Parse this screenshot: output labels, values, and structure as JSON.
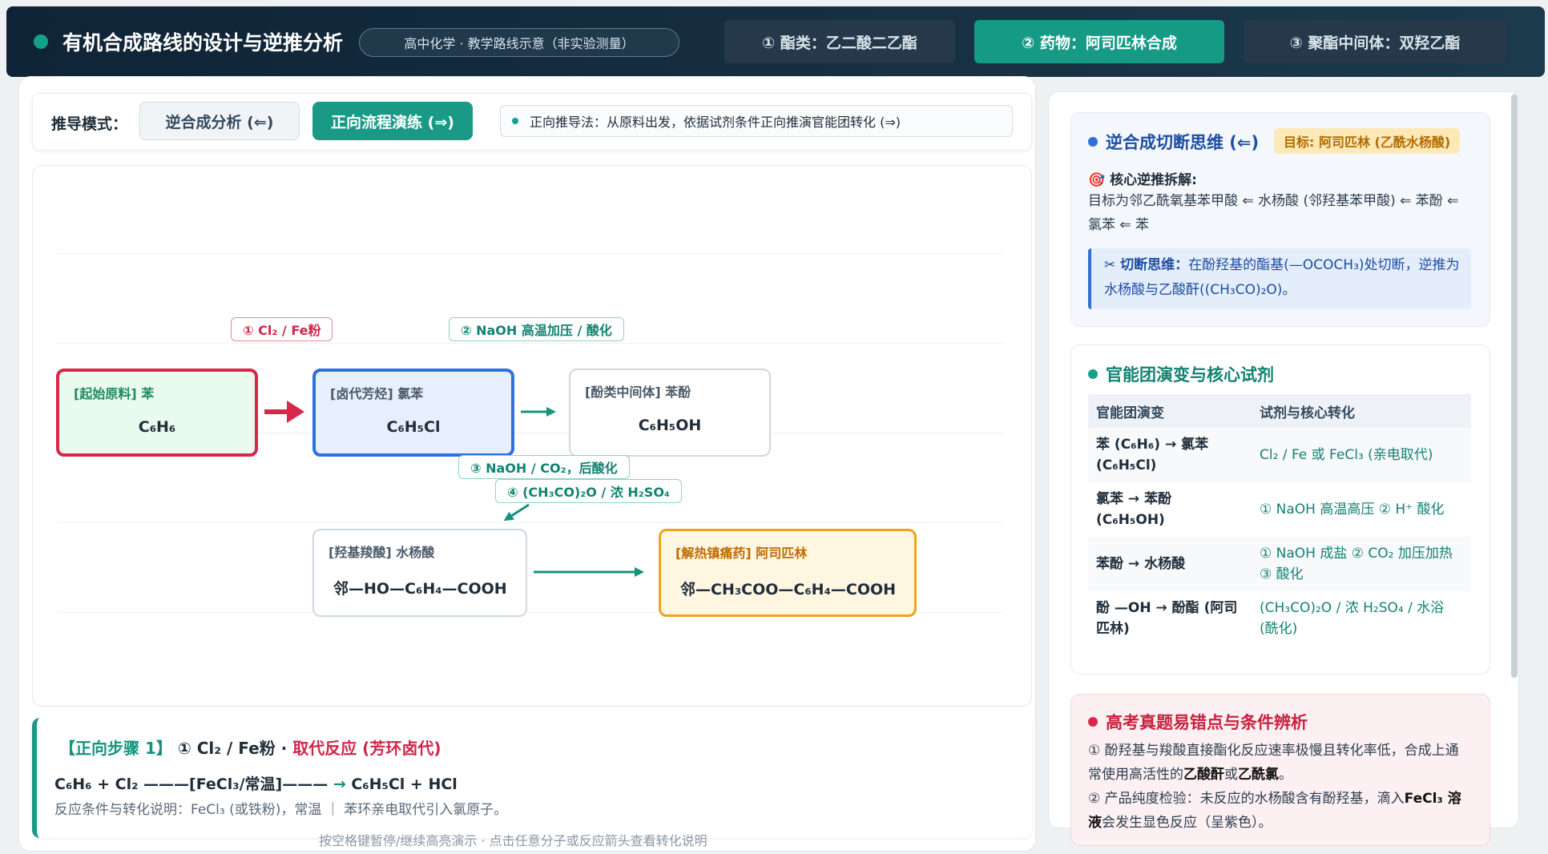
{
  "header": {
    "title": "有机合成路线的设计与逆推分析",
    "badge": "高中化学 · 教学路线示意（非实验测量）",
    "tabs": [
      {
        "label": "① 酯类：乙二酸二乙酯",
        "active": false
      },
      {
        "label": "② 药物：阿司匹林合成",
        "active": true
      },
      {
        "label": "③ 聚酯中间体：双羟乙酯",
        "active": false
      }
    ]
  },
  "mode": {
    "label": "推导模式：",
    "options": [
      "逆合成分析 (⇐)",
      "正向流程演练 (⇒)"
    ],
    "active": "正向流程演练 (⇒)",
    "hint": "正向推导法：从原料出发，依据试剂条件正向推演官能团转化 (⇒)"
  },
  "nodes": [
    {
      "label": "[起始原料] 苯",
      "formula": "C₆H₆"
    },
    {
      "label": "[卤代芳烃] 氯苯",
      "formula": "C₆H₅Cl"
    },
    {
      "label": "[酚类中间体] 苯酚",
      "formula": "C₆H₅OH"
    },
    {
      "label": "[羟基羧酸] 水杨酸",
      "formula": "邻—HO—C₆H₄—COOH"
    },
    {
      "label": "[解热镇痛药] 阿司匹林",
      "formula": "邻—CH₃COO—C₆H₄—COOH"
    }
  ],
  "conditions": [
    "① Cl₂ / Fe粉",
    "② NaOH 高温加压 / 酸化",
    "③ NaOH / CO₂，后酸化",
    "④ (CH₃CO)₂O / 浓 H₂SO₄"
  ],
  "step": {
    "tag": "【正向步骤 1】",
    "name": " ① Cl₂ / Fe粉 · ",
    "type": "取代反应 (芳环卤代)",
    "equation_left": "C₆H₆ + Cl₂ ———[FeCl₃/常温]——— ",
    "equation_arrow": "→",
    "equation_right": " C₆H₅Cl + HCl",
    "note": "反应条件与转化说明：FeCl₃ (或铁粉)，常温 ｜ 苯环亲电取代引入氯原子。"
  },
  "footer_hint": "按空格键暂停/继续高亮演示 · 点击任意分子或反应箭头查看转化说明",
  "retro": {
    "title": "逆合成切断思维 (⇐)",
    "target": "目标: 阿司匹林 (乙酰水杨酸)",
    "sub_head": "🎯 核心逆推拆解:",
    "chain": "目标为邻乙酰氧基苯甲酸 ⇐ 水杨酸 (邻羟基苯甲酸) ⇐ 苯酚 ⇐ 氯苯 ⇐ 苯",
    "cut_label": "✂ 切断思维：",
    "cut_text": "在酚羟基的酯基(—OCOCH₃)处切断，逆推为水杨酸与乙酸酐((CH₃CO)₂O)。"
  },
  "fg_table": {
    "title": "官能团演变与核心试剂",
    "headers": [
      "官能团演变",
      "试剂与核心转化"
    ],
    "rows": [
      {
        "change": "苯 (C₆H₆) → 氯苯 (C₆H₅Cl)",
        "reagent": "Cl₂ / Fe 或 FeCl₃ (亲电取代)"
      },
      {
        "change": "氯苯 → 苯酚 (C₆H₅OH)",
        "reagent": "① NaOH 高温高压 ② H⁺ 酸化"
      },
      {
        "change": "苯酚 → 水杨酸",
        "reagent": "① NaOH 成盐 ② CO₂ 加压加热 ③ 酸化"
      },
      {
        "change": "酚 —OH → 酚酯 (阿司匹林)",
        "reagent": "(CH₃CO)₂O / 浓 H₂SO₄ / 水浴 (酰化)"
      }
    ]
  },
  "pitfalls": {
    "title": "高考真题易错点与条件辨析",
    "p1_a": "① 酚羟基与羧酸直接酯化反应速率极慢且转化率低，合成上通常使用高活性的",
    "p1_b": "乙酸酐",
    "p1_c": "或",
    "p1_d": "乙酰氯",
    "p1_e": "。",
    "p2_a": "② 产品纯度检验：未反应的水杨酸含有酚羟基，滴入",
    "p2_b": "FeCl₃ 溶液",
    "p2_c": "会发生显色反应（呈紫色）。"
  },
  "colors": {
    "accent": "#1a9a86",
    "start_border": "#d9274a",
    "active_border": "#2f6fe0",
    "product_border": "#f0a21a"
  }
}
